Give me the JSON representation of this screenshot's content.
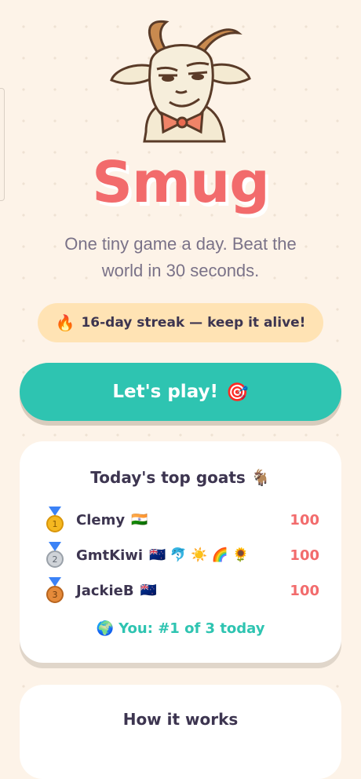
{
  "app": {
    "title": "Smug",
    "tagline": "One tiny game a day. Beat the world in 30 seconds.",
    "mascot_icon": "goat-with-bowtie-icon"
  },
  "streak": {
    "icon": "fire-icon",
    "emoji": "🔥",
    "text": "16-day streak — keep it alive!"
  },
  "play_button": {
    "label": "Let's play!",
    "icon": "target-icon",
    "emoji": "🎯"
  },
  "leaderboard": {
    "title": "Today's top goats",
    "title_emoji": "🐐",
    "rows": [
      {
        "rank": 1,
        "medal": "gold-medal-icon",
        "name": "Clemy",
        "emoji": "🇮🇳",
        "score": "100"
      },
      {
        "rank": 2,
        "medal": "silver-medal-icon",
        "name": "GmtKiwi",
        "emoji": "🇳🇿 🐬 ☀️ 🌈 🌻",
        "score": "100"
      },
      {
        "rank": 3,
        "medal": "bronze-medal-icon",
        "name": "JackieB",
        "emoji": "🇳🇿",
        "score": "100"
      }
    ],
    "you": {
      "icon": "globe-icon",
      "emoji": "🌍",
      "text": "You: #1 of 3 today"
    }
  },
  "how_it_works": {
    "title": "How it works"
  },
  "colors": {
    "background": "#fdf3e8",
    "brand": "#f26b6c",
    "accent": "#2ec4b1",
    "streak_bg": "#ffe3b4",
    "text": "#3d3550",
    "muted": "#7a7288"
  }
}
